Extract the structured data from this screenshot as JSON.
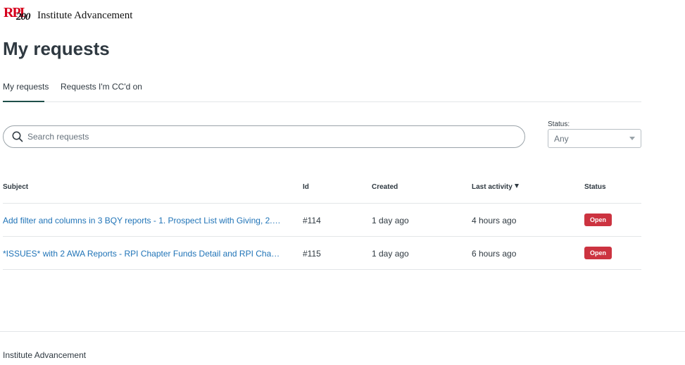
{
  "header": {
    "logo_mark_text": "RPI",
    "logo_mark_number": "200",
    "logo_text": "Institute Advancement"
  },
  "page_title": "My requests",
  "tabs": [
    {
      "label": "My requests",
      "active": true
    },
    {
      "label": "Requests I'm CC'd on",
      "active": false
    }
  ],
  "search": {
    "placeholder": "Search requests",
    "value": ""
  },
  "status_filter": {
    "label": "Status:",
    "value": "Any"
  },
  "table": {
    "columns": [
      "Subject",
      "Id",
      "Created",
      "Last activity",
      "Status"
    ],
    "rows": [
      {
        "subject": "Add filter and columns in 3 BQY reports - 1. Prospect List with Giving, 2.Pr...",
        "id": "#114",
        "created": "1 day ago",
        "last_activity": "4 hours ago",
        "status": "Open"
      },
      {
        "subject": "*ISSUES* with 2 AWA Reports - RPI Chapter Funds Detail and RPI Chapter ...",
        "id": "#115",
        "created": "1 day ago",
        "last_activity": "6 hours ago",
        "status": "Open"
      }
    ]
  },
  "footer": {
    "text": "Institute Advancement"
  },
  "colors": {
    "link": "#1f73b7",
    "badge_open": "#cc3340",
    "active_tab": "#1f4f4a",
    "logo_red": "#d6001c"
  }
}
